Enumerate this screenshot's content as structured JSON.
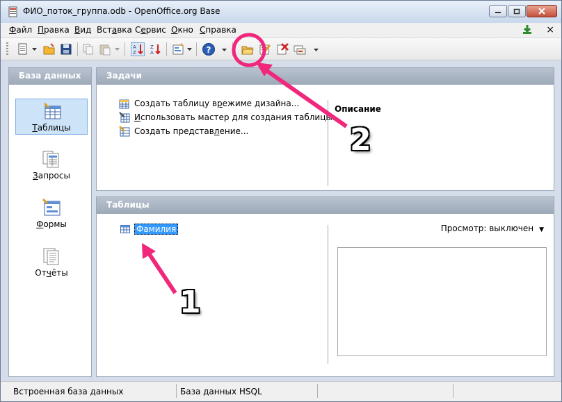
{
  "window": {
    "title": "ФИО_поток_группа.odb - OpenOffice.org Base"
  },
  "menubar": {
    "items": [
      {
        "pre": "",
        "u": "Ф",
        "post": "айл"
      },
      {
        "pre": "",
        "u": "П",
        "post": "равка"
      },
      {
        "pre": "",
        "u": "В",
        "post": "ид"
      },
      {
        "pre": "Вст",
        "u": "а",
        "post": "вка"
      },
      {
        "pre": "С",
        "u": "е",
        "post": "рвис"
      },
      {
        "pre": "",
        "u": "О",
        "post": "кно"
      },
      {
        "pre": "",
        "u": "С",
        "post": "правка"
      }
    ],
    "close_glyph": "×"
  },
  "left_panel": {
    "header": "База данных",
    "items": [
      {
        "pre": "",
        "u": "Т",
        "post": "аблицы"
      },
      {
        "pre": "",
        "u": "З",
        "post": "апросы"
      },
      {
        "pre": "",
        "u": "Ф",
        "post": "ормы"
      },
      {
        "pre": "От",
        "u": "ч",
        "post": "ёты"
      }
    ]
  },
  "tasks": {
    "header": "Задачи",
    "items": [
      {
        "pre": "Создать таблицу в ",
        "u": "р",
        "post": "ежиме дизайна..."
      },
      {
        "pre": "",
        "u": "И",
        "post": "спользовать мастер для создания таблицы..."
      },
      {
        "pre": "Создать представ",
        "u": "л",
        "post": "ение..."
      }
    ],
    "description_label": "Описание"
  },
  "tables": {
    "header": "Таблицы",
    "entries": [
      "Фамилия"
    ],
    "preview_label": "Просмотр: выключен",
    "preview_arrow": "▼"
  },
  "statusbar": {
    "left": "Встроенная база данных",
    "middle": "База данных HSQL"
  },
  "annotations": {
    "label_1": "1",
    "label_2": "2",
    "color": "#f0277b"
  }
}
